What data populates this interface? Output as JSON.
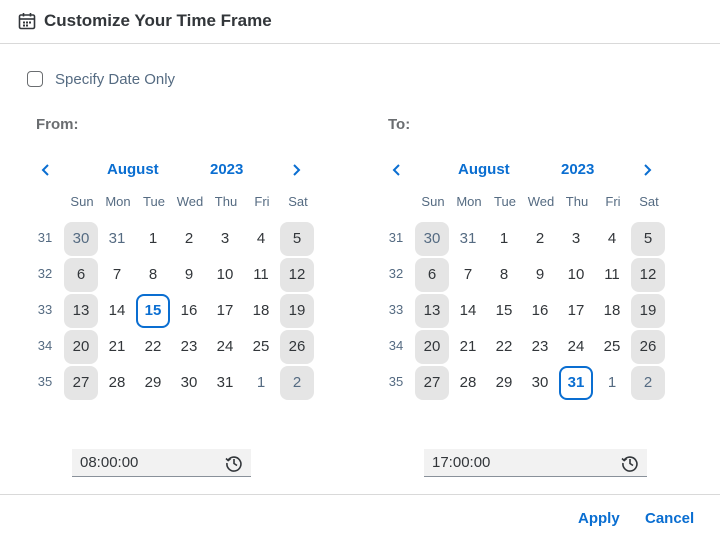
{
  "dialog": {
    "title": "Customize Your Time Frame"
  },
  "specify_date_only": {
    "label": "Specify Date Only",
    "checked": false
  },
  "from": {
    "label": "From:",
    "month": "August",
    "year": "2023",
    "selected_day": "15",
    "time": "08:00:00"
  },
  "to": {
    "label": "To:",
    "month": "August",
    "year": "2023",
    "selected_day": "31",
    "time": "17:00:00"
  },
  "weekdays": [
    "Sun",
    "Mon",
    "Tue",
    "Wed",
    "Thu",
    "Fri",
    "Sat"
  ],
  "weeks": [
    {
      "number": "31",
      "days": [
        "30",
        "31",
        "1",
        "2",
        "3",
        "4",
        "5"
      ]
    },
    {
      "number": "32",
      "days": [
        "6",
        "7",
        "8",
        "9",
        "10",
        "11",
        "12"
      ]
    },
    {
      "number": "33",
      "days": [
        "13",
        "14",
        "15",
        "16",
        "17",
        "18",
        "19"
      ]
    },
    {
      "number": "34",
      "days": [
        "20",
        "21",
        "22",
        "23",
        "24",
        "25",
        "26"
      ]
    },
    {
      "number": "35",
      "days": [
        "27",
        "28",
        "29",
        "30",
        "31",
        "1",
        "2"
      ]
    }
  ],
  "footer": {
    "apply_label": "Apply",
    "cancel_label": "Cancel"
  },
  "colors": {
    "accent": "#0a6ed1",
    "weekend_bg": "#e5e5e5",
    "text": "#32363a",
    "muted": "#556b82"
  },
  "icons": {
    "header": "calendar-icon",
    "prev": "chevron-left-icon",
    "next": "chevron-right-icon",
    "time": "time-history-icon"
  }
}
